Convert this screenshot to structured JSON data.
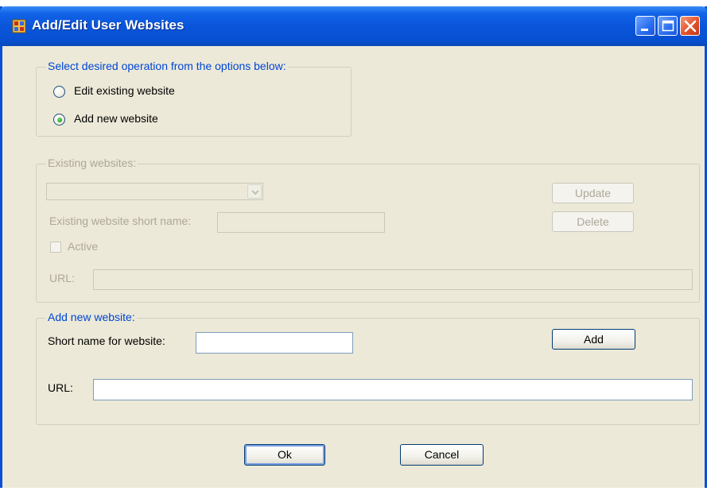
{
  "window": {
    "title": "Add/Edit User Websites",
    "controls": {
      "minimize": "minimize",
      "maximize": "maximize",
      "close": "close"
    }
  },
  "operation": {
    "legend": "Select desired operation from the options below:",
    "options": [
      {
        "label": "Edit existing website",
        "selected": false
      },
      {
        "label": "Add new website",
        "selected": true
      }
    ]
  },
  "existing": {
    "legend": "Existing websites:",
    "website_select_value": "",
    "update_label": "Update",
    "delete_label": "Delete",
    "short_name_label": "Existing website short name:",
    "short_name_value": "",
    "active_label": "Active",
    "active_checked": false,
    "url_label": "URL:",
    "url_value": ""
  },
  "add_new": {
    "legend": "Add new website:",
    "short_name_label": "Short name for website:",
    "short_name_value": "",
    "add_label": "Add",
    "url_label": "URL:",
    "url_value": ""
  },
  "footer": {
    "ok_label": "Ok",
    "cancel_label": "Cancel"
  },
  "colors": {
    "titlebar": "#0a55da",
    "window_bg": "#ece9d8",
    "group_label": "#0046d5",
    "disabled_text": "#ada899"
  }
}
